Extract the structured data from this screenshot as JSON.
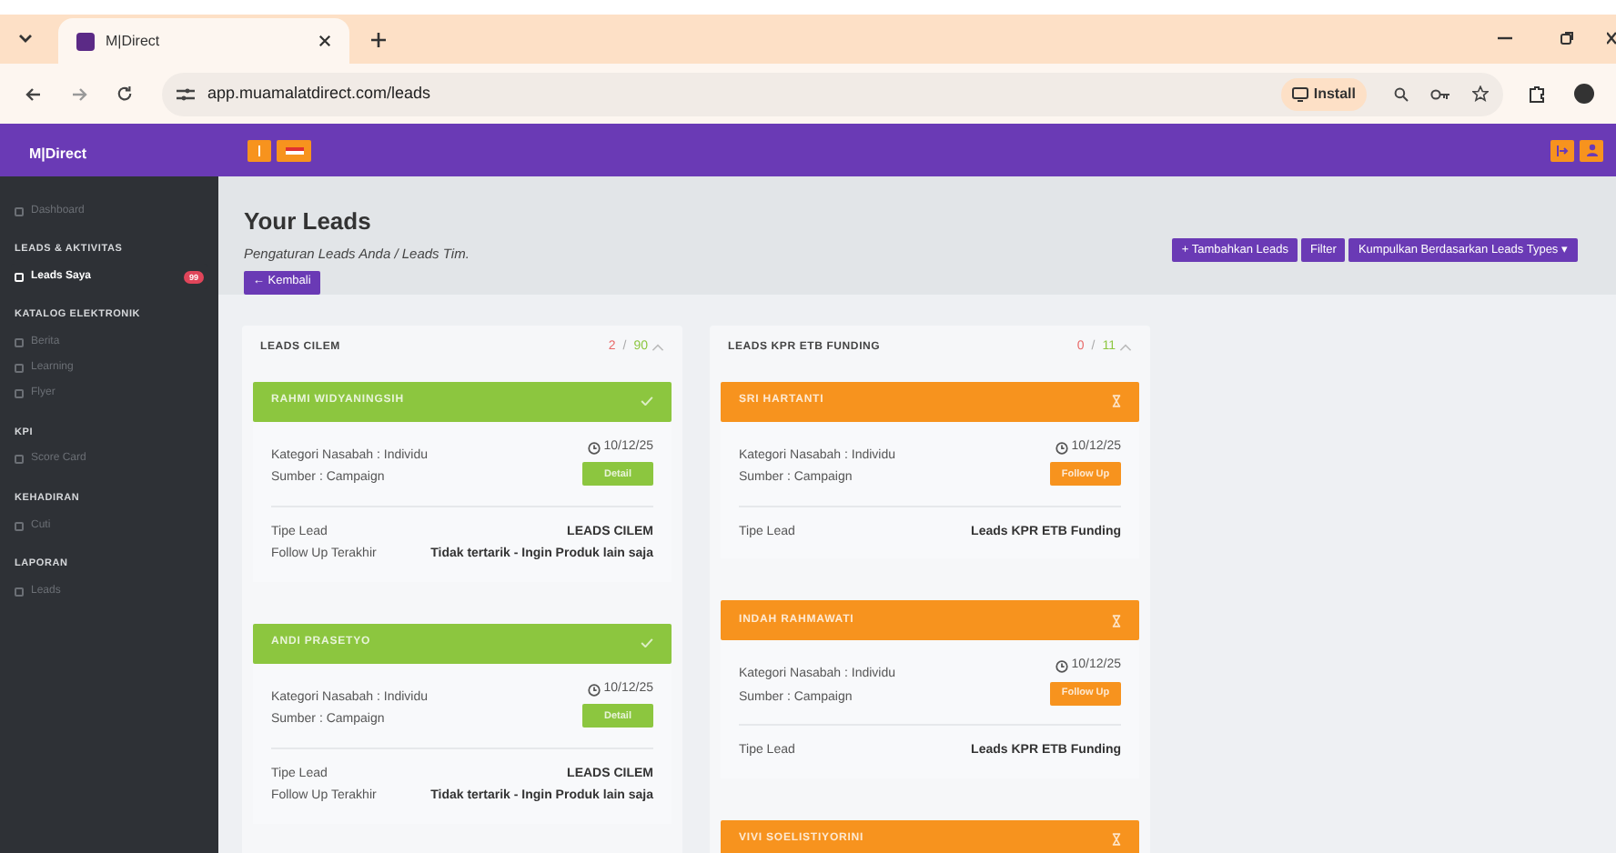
{
  "browser": {
    "tab_title": "M|Direct",
    "url": "app.muamalatdirect.com/leads",
    "install": "Install"
  },
  "app_header": {
    "logo": "M|Direct"
  },
  "sidebar": {
    "items": [
      {
        "kind": "item",
        "label": "Dashboard",
        "selected": false
      },
      {
        "kind": "heading",
        "label": "LEADS & AKTIVITAS"
      },
      {
        "kind": "item",
        "label": "Leads Saya",
        "selected": true,
        "badge": "99"
      },
      {
        "kind": "heading",
        "label": "KATALOG ELEKTRONIK"
      },
      {
        "kind": "item",
        "label": "Berita",
        "selected": false
      },
      {
        "kind": "item",
        "label": "Learning",
        "selected": false
      },
      {
        "kind": "item",
        "label": "Flyer",
        "selected": false
      },
      {
        "kind": "heading",
        "label": "KPI"
      },
      {
        "kind": "item",
        "label": "Score Card",
        "selected": false
      },
      {
        "kind": "heading",
        "label": "KEHADIRAN"
      },
      {
        "kind": "item",
        "label": "Cuti",
        "selected": false
      },
      {
        "kind": "heading",
        "label": "LAPORAN"
      },
      {
        "kind": "item",
        "label": "Leads",
        "selected": false
      }
    ]
  },
  "page": {
    "title": "Your Leads",
    "subtitle": "Pengaturan Leads Anda / Leads Tim.",
    "back_button": "← Kembali",
    "actions": [
      "+ Tambahkan Leads",
      "Filter",
      "Kumpulkan Berdasarkan Leads Types ▾"
    ]
  },
  "columns": [
    {
      "title": "LEADS CILEM",
      "done": "2",
      "separator": "/",
      "total": "90",
      "leads": [
        {
          "name": "RAHMI WIDYANINGSIH",
          "kind": "done",
          "date": "10/12/25",
          "category": "Kategori Nasabah : Individu",
          "source": "Sumber : Campaign",
          "button": "Detail",
          "rows": [
            {
              "label": "Tipe Lead",
              "value": "LEADS CILEM"
            },
            {
              "label": "Follow Up Terakhir",
              "value": "Tidak tertarik - Ingin Produk lain saja"
            }
          ]
        },
        {
          "name": "ANDI PRASETYO",
          "kind": "done",
          "date": "10/12/25",
          "category": "Kategori Nasabah : Individu",
          "source": "Sumber : Campaign",
          "button": "Detail",
          "rows": [
            {
              "label": "Tipe Lead",
              "value": "LEADS CILEM"
            },
            {
              "label": "Follow Up Terakhir",
              "value": "Tidak tertarik - Ingin Produk lain saja"
            }
          ]
        }
      ]
    },
    {
      "title": "LEADS KPR ETB FUNDING",
      "done": "0",
      "separator": "/",
      "total": "11",
      "leads": [
        {
          "name": "SRI HARTANTI",
          "kind": "pending",
          "date": "10/12/25",
          "category": "Kategori Nasabah : Individu",
          "source": "Sumber : Campaign",
          "button": "Follow Up",
          "rows": [
            {
              "label": "Tipe Lead",
              "value": "Leads KPR ETB Funding"
            }
          ]
        },
        {
          "name": "INDAH RAHMAWATI",
          "kind": "pending",
          "date": "10/12/25",
          "category": "Kategori Nasabah : Individu",
          "source": "Sumber : Campaign",
          "button": "Follow Up",
          "rows": [
            {
              "label": "Tipe Lead",
              "value": "Leads KPR ETB Funding"
            }
          ]
        },
        {
          "name": "VIVI SOELISTIYORINI",
          "kind": "pending"
        }
      ]
    }
  ]
}
